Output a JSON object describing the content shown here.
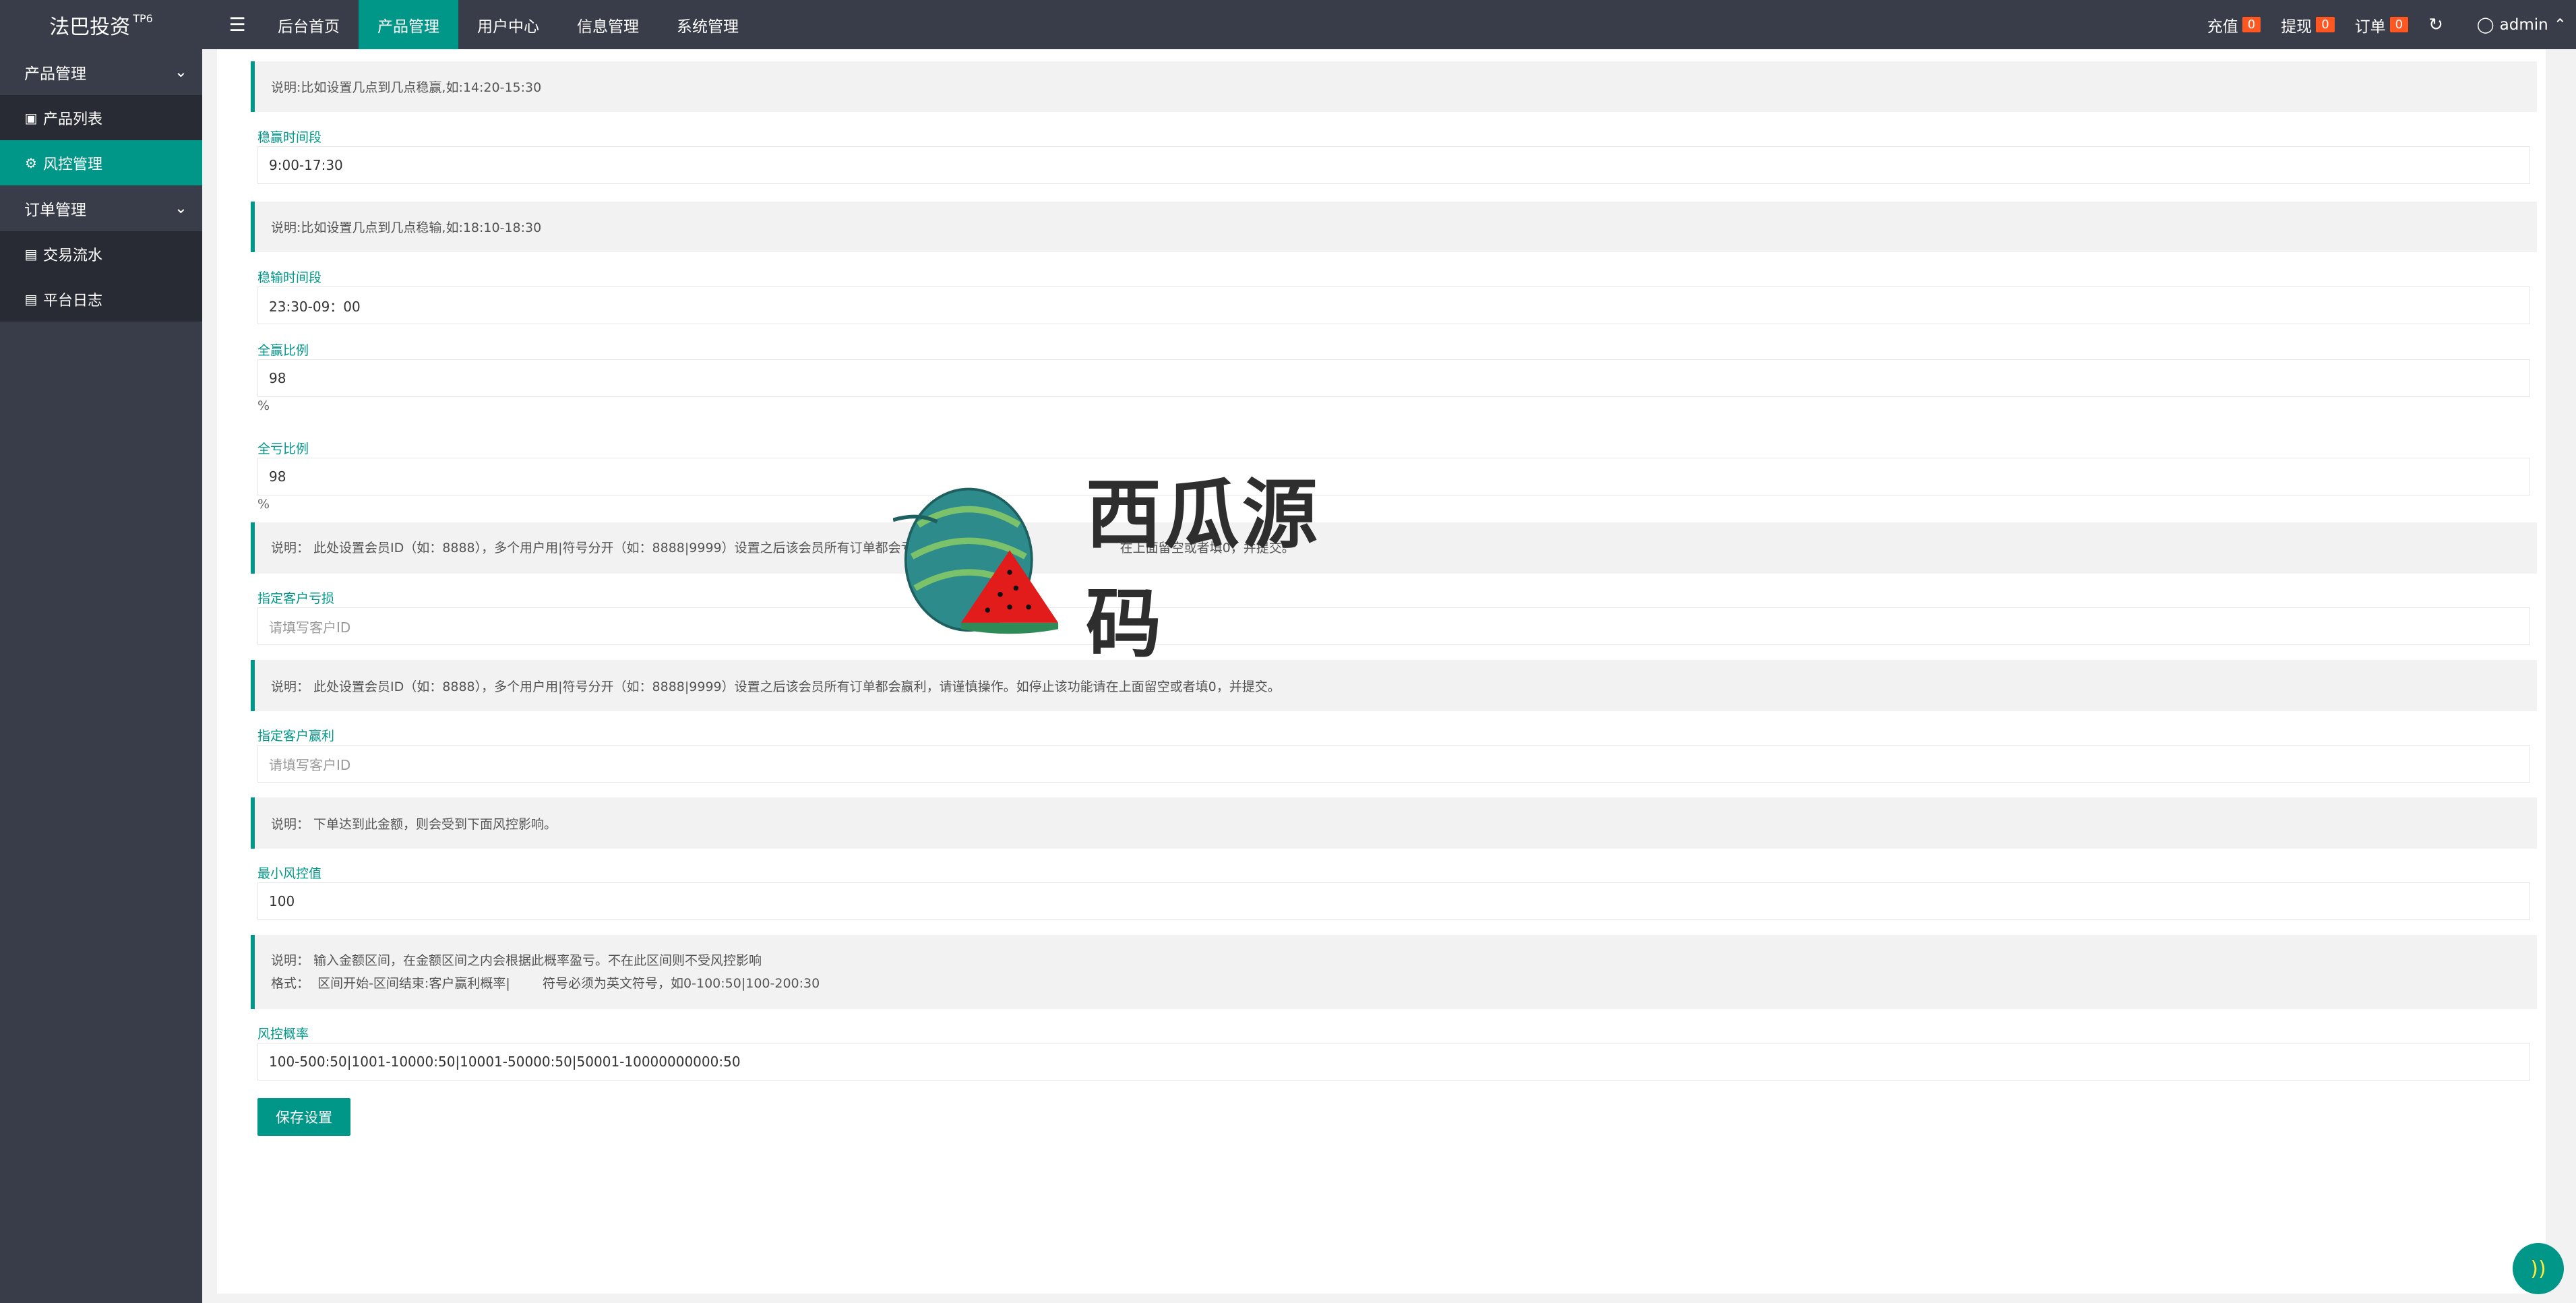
{
  "app": {
    "title": "法巴投资",
    "version_tag": "TP6"
  },
  "header": {
    "menu_icon": "hamburger-icon",
    "nav": [
      {
        "label": "后台首页",
        "active": false
      },
      {
        "label": "产品管理",
        "active": true
      },
      {
        "label": "用户中心",
        "active": false
      },
      {
        "label": "信息管理",
        "active": false
      },
      {
        "label": "系统管理",
        "active": false
      }
    ],
    "recharge_label": "充值",
    "recharge_count": "0",
    "withdraw_label": "提现",
    "withdraw_count": "0",
    "order_label": "订单",
    "order_count": "0",
    "user": "admin",
    "colors": {
      "bar": "#393d49",
      "accent": "#009688",
      "badge": "#ff5722"
    }
  },
  "sidebar": {
    "groups": [
      {
        "label": "产品管理",
        "items": [
          {
            "label": "产品列表",
            "icon": "cube-icon",
            "active": false
          },
          {
            "label": "风控管理",
            "icon": "gear-icon",
            "active": true
          }
        ]
      },
      {
        "label": "订单管理",
        "items": [
          {
            "label": "交易流水",
            "icon": "document-icon",
            "active": false
          },
          {
            "label": "平台日志",
            "icon": "document-icon",
            "active": false
          }
        ]
      }
    ]
  },
  "form": {
    "note_win": "说明:比如设置几点到几点稳赢,如:14:20-15:30",
    "win_label": "稳赢时间段",
    "win_value": "9:00-17:30",
    "note_lose": "说明:比如设置几点到几点稳输,如:18:10-18:30",
    "lose_label": "稳输时间段",
    "lose_value": "23:30-09：00",
    "all_win_label": "全赢比例",
    "all_win_value": "98",
    "all_win_unit": "%",
    "all_lose_label": "全亏比例",
    "all_lose_value": "98",
    "all_lose_unit": "%",
    "note_lose_users": "说明：  此处设置会员ID（如：8888），多个用户用|符号分开（如：8888|9999）设置之后该会员所有订单都会亏损，请谨",
    "note_lose_users_tail": "在上面留空或者填0，并提交。",
    "lose_users_label": "指定客户亏损",
    "lose_users_placeholder": "请填写客户ID",
    "note_win_users": "说明：  此处设置会员ID（如：8888），多个用户用|符号分开（如：8888|9999）设置之后该会员所有订单都会赢利，请谨慎操作。如停止该功能请在上面留空或者填0，并提交。",
    "win_users_label": "指定客户赢利",
    "win_users_placeholder": "请填写客户ID",
    "note_min": "说明：  下单达到此金额，则会受到下面风控影响。",
    "min_label": "最小风控值",
    "min_value": "100",
    "note_rate_1": "说明：  输入金额区间，在金额区间之内会根据此概率盈亏。不在此区间则不受风控影响",
    "note_rate_2": "格式：  区间开始-区间结束:客户赢利概率|        符号必须为英文符号，如0-100:50|100-200:30",
    "rate_label": "风控概率",
    "rate_value": "100-500:50|1001-10000:50|10001-50000:50|50001-10000000000:50",
    "save_label": "保存设置"
  },
  "watermark": {
    "text": "西瓜源码",
    "icon": "watermelon-logo-icon"
  },
  "fab": {
    "icon": "sound-wave-icon"
  }
}
